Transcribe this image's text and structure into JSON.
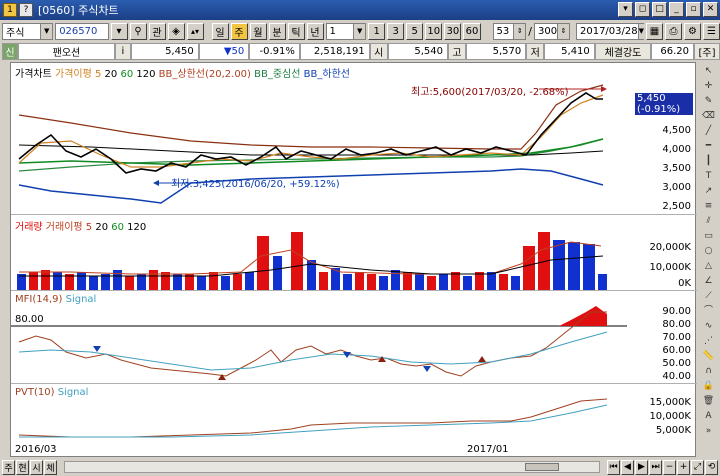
{
  "window": {
    "title": "[0560] 주식차트"
  },
  "toolbar": {
    "market": "주식",
    "code": "026570",
    "chart_type_label": "관",
    "period_buttons": [
      "일",
      "주",
      "월",
      "분",
      "틱",
      "년"
    ],
    "interval": "1",
    "interval_buttons": [
      "1",
      "3",
      "5",
      "10",
      "30",
      "60"
    ],
    "count": "53",
    "total": "300",
    "date": "2017/03/28"
  },
  "info": {
    "tag": "신",
    "name": "팬오션",
    "price": "5,450",
    "change": "▼50",
    "change_pct": "-0.91%",
    "volume": "2,518,191",
    "open_label": "시",
    "open": "5,540",
    "high_label": "고",
    "high": "5,570",
    "low_label": "저",
    "low": "5,410",
    "strength_label": "체결강도",
    "strength": "66.20",
    "unit": "[주]"
  },
  "panels": {
    "price": {
      "legend": [
        "가격차트",
        "가격이평 5",
        "20",
        "60",
        "120",
        "BB_상한선(20,2.00)",
        "BB_중심선",
        "BB_하한선"
      ],
      "annotation_high": "최고:5,600(2017/03/20, -2.68%)",
      "annotation_low": "최저:3,425(2016/06/20, +59.12%)",
      "current_price": "5,450",
      "current_pct": "(-0.91%)",
      "yticks": [
        "4,500",
        "4,000",
        "3,500",
        "3,000",
        "2,500"
      ]
    },
    "volume": {
      "legend": [
        "거래량",
        "거래이평 5",
        "20",
        "60",
        "120"
      ],
      "yticks": [
        "20,000K",
        "10,000K",
        "0K"
      ]
    },
    "mfi": {
      "legend": [
        "MFI(14,9)",
        "Signal"
      ],
      "threshold": "80.00",
      "yticks": [
        "90.00",
        "80.00",
        "70.00",
        "60.00",
        "50.00",
        "40.00"
      ]
    },
    "pvt": {
      "legend": [
        "PVT(10)",
        "Signal"
      ],
      "yticks": [
        "15,000K",
        "10,000K",
        "5,000K"
      ]
    }
  },
  "xaxis": {
    "left": "2016/03",
    "mid": "2017/01"
  },
  "colors": {
    "up": "#e01010",
    "down": "#1030d0",
    "ma5": "#d08020",
    "ma20": "#000000",
    "ma60": "#10a030",
    "ma120": "#000000",
    "bb_upper": "#b04020",
    "bb_mid": "#208040",
    "bb_lower": "#1040b0"
  },
  "bottom": {
    "buttons": [
      "주",
      "현",
      "시",
      "체"
    ]
  }
}
